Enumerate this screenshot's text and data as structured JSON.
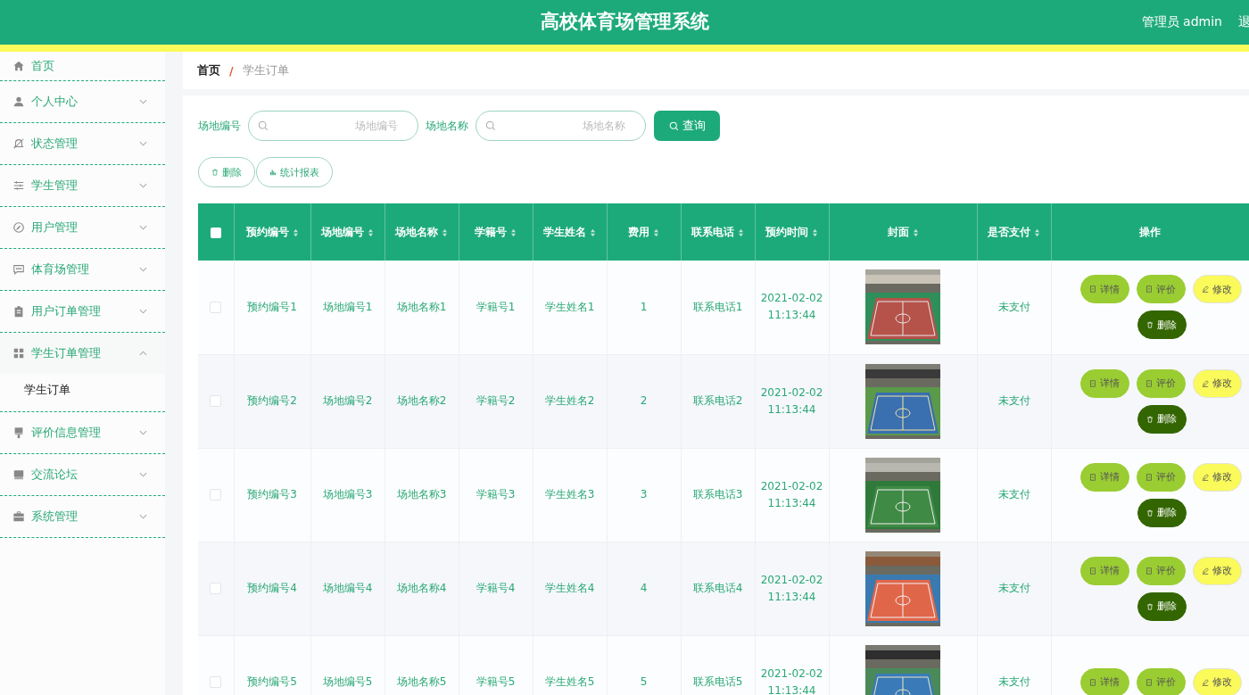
{
  "header": {
    "title": "高校体育场管理系统",
    "user": "管理员 admin",
    "logout": "退"
  },
  "sidebar": {
    "items": [
      {
        "label": "首页"
      },
      {
        "label": "个人中心",
        "expandable": true,
        "expanded": false
      },
      {
        "label": "状态管理",
        "expandable": true,
        "expanded": false
      },
      {
        "label": "学生管理",
        "expandable": true,
        "expanded": false
      },
      {
        "label": "用户管理",
        "expandable": true,
        "expanded": false
      },
      {
        "label": "体育场管理",
        "expandable": true,
        "expanded": false
      },
      {
        "label": "用户订单管理",
        "expandable": true,
        "expanded": false
      },
      {
        "label": "学生订单管理",
        "expandable": true,
        "expanded": true,
        "children": [
          {
            "label": "学生订单"
          }
        ]
      },
      {
        "label": "评价信息管理",
        "expandable": true,
        "expanded": false
      },
      {
        "label": "交流论坛",
        "expandable": true,
        "expanded": false
      },
      {
        "label": "系统管理",
        "expandable": true,
        "expanded": false
      }
    ]
  },
  "breadcrumb": {
    "items": [
      "首页",
      "学生订单"
    ],
    "separator": "/"
  },
  "search": [
    {
      "label": "场地编号",
      "placeholder": "场地编号"
    },
    {
      "label": "场地名称",
      "placeholder": "场地名称"
    }
  ],
  "search_button": "查询",
  "toolbar": [
    {
      "label": "删除",
      "kind": "delete"
    },
    {
      "label": "统计报表",
      "kind": "chart"
    }
  ],
  "table": {
    "select_all_checked": false,
    "columns": [
      {
        "label": "预约编号",
        "sortable": true
      },
      {
        "label": "场地编号",
        "sortable": true
      },
      {
        "label": "场地名称",
        "sortable": true
      },
      {
        "label": "学籍号",
        "sortable": true
      },
      {
        "label": "学生姓名",
        "sortable": true
      },
      {
        "label": "费用",
        "sortable": true
      },
      {
        "label": "联系电话",
        "sortable": true
      },
      {
        "label": "预约时间",
        "sortable": true
      },
      {
        "label": "封面",
        "sortable": true
      },
      {
        "label": "是否支付",
        "sortable": true
      },
      {
        "label": "操作",
        "sortable": false
      }
    ],
    "rows": [
      {
        "checked": false,
        "cells": [
          "预约编号1",
          "场地编号1",
          "场地名称1",
          "学籍号1",
          "学生姓名1",
          "1",
          "联系电话1",
          "2021-02-02 11:13:44"
        ],
        "cover": {
          "kind": "picture"
        },
        "paid": "未支付",
        "actions": [
          {
            "label": "详情",
            "kind": "detail"
          },
          {
            "label": "评价",
            "kind": "review"
          },
          {
            "label": "修改",
            "kind": "edit"
          },
          {
            "label": "删除",
            "kind": "delete"
          }
        ]
      },
      {
        "checked": false,
        "cells": [
          "预约编号2",
          "场地编号2",
          "场地名称2",
          "学籍号2",
          "学生姓名2",
          "2",
          "联系电话2",
          "2021-02-02 11:13:44"
        ],
        "cover": {
          "kind": "picture"
        },
        "paid": "未支付",
        "actions": [
          {
            "label": "详情",
            "kind": "detail"
          },
          {
            "label": "评价",
            "kind": "review"
          },
          {
            "label": "修改",
            "kind": "edit"
          },
          {
            "label": "删除",
            "kind": "delete"
          }
        ]
      },
      {
        "checked": false,
        "cells": [
          "预约编号3",
          "场地编号3",
          "场地名称3",
          "学籍号3",
          "学生姓名3",
          "3",
          "联系电话3",
          "2021-02-02 11:13:44"
        ],
        "cover": {
          "kind": "picture"
        },
        "paid": "未支付",
        "actions": [
          {
            "label": "详情",
            "kind": "detail"
          },
          {
            "label": "评价",
            "kind": "review"
          },
          {
            "label": "修改",
            "kind": "edit"
          },
          {
            "label": "删除",
            "kind": "delete"
          }
        ]
      },
      {
        "checked": false,
        "cells": [
          "预约编号4",
          "场地编号4",
          "场地名称4",
          "学籍号4",
          "学生姓名4",
          "4",
          "联系电话4",
          "2021-02-02 11:13:44"
        ],
        "cover": {
          "kind": "picture"
        },
        "paid": "未支付",
        "actions": [
          {
            "label": "详情",
            "kind": "detail"
          },
          {
            "label": "评价",
            "kind": "review"
          },
          {
            "label": "修改",
            "kind": "edit"
          },
          {
            "label": "删除",
            "kind": "delete"
          }
        ]
      },
      {
        "checked": false,
        "cells": [
          "预约编号5",
          "场地编号5",
          "场地名称5",
          "学籍号5",
          "学生姓名5",
          "5",
          "联系电话5",
          "2021-02-02 11:13:44"
        ],
        "cover": {
          "kind": "picture"
        },
        "paid": "未支付",
        "actions": [
          {
            "label": "详情",
            "kind": "detail"
          },
          {
            "label": "评价",
            "kind": "review"
          },
          {
            "label": "修改",
            "kind": "edit"
          }
        ]
      }
    ]
  }
}
